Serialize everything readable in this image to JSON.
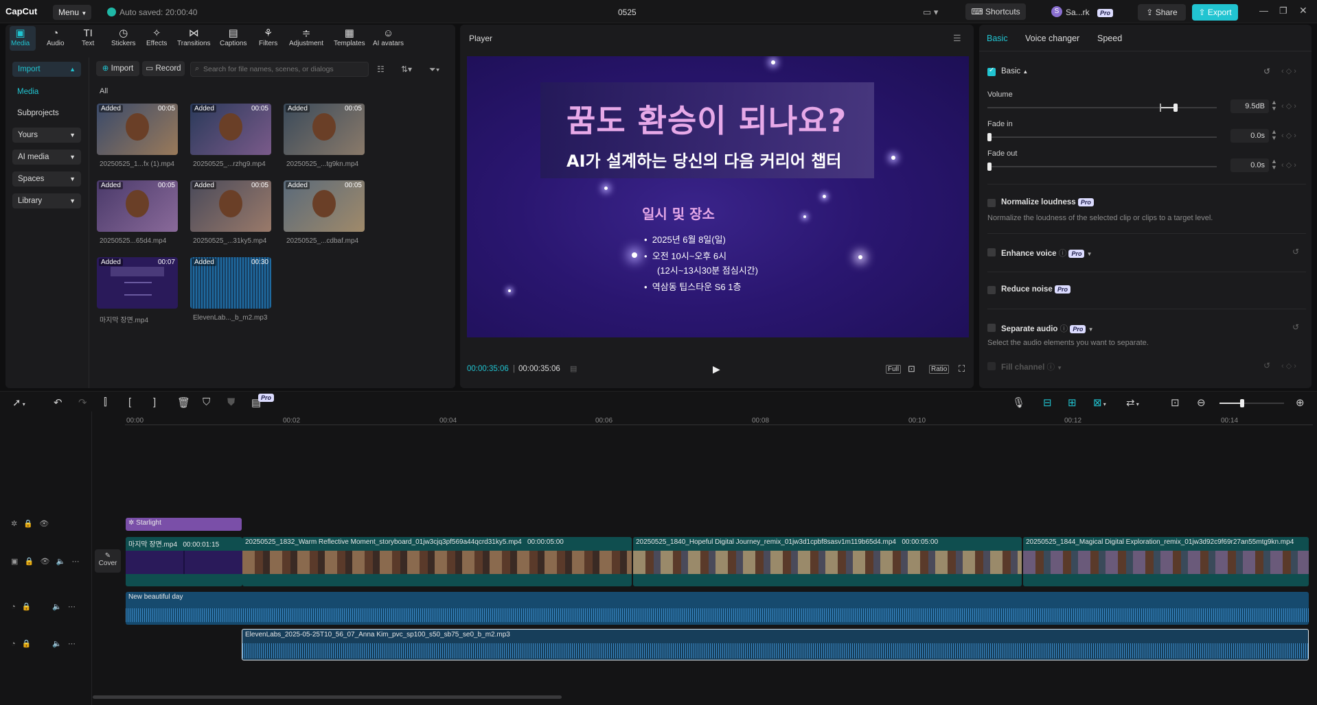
{
  "app": {
    "name": "CapCut",
    "menu_label": "Menu",
    "autosave": "Auto saved: 20:00:40",
    "project_title": "0525"
  },
  "topbar": {
    "shortcuts": "Shortcuts",
    "user": "Sa...rk",
    "pro_badge": "Pro",
    "share": "Share",
    "export": "Export",
    "user_initial": "S"
  },
  "toolbar": {
    "items": [
      "Media",
      "Audio",
      "Text",
      "Stickers",
      "Effects",
      "Transitions",
      "Captions",
      "Filters",
      "Adjustment",
      "Templates",
      "AI avatars"
    ]
  },
  "sidebar": {
    "import": "Import",
    "media": "Media",
    "subprojects": "Subprojects",
    "yours": "Yours",
    "ai_media": "AI media",
    "spaces": "Spaces",
    "library": "Library"
  },
  "media_panel": {
    "import_btn": "Import",
    "record_btn": "Record",
    "search_placeholder": "Search for file names, scenes, or dialogs",
    "filter_all": "All",
    "items": [
      {
        "name": "20250525_1...fx (1).mp4",
        "badge": "Added",
        "duration": "00:05"
      },
      {
        "name": "20250525_...rzhg9.mp4",
        "badge": "Added",
        "duration": "00:05"
      },
      {
        "name": "20250525_...tg9kn.mp4",
        "badge": "Added",
        "duration": "00:05"
      },
      {
        "name": "20250525...65d4.mp4",
        "badge": "Added",
        "duration": "00:05"
      },
      {
        "name": "20250525_...31ky5.mp4",
        "badge": "Added",
        "duration": "00:05"
      },
      {
        "name": "20250525_...cdbaf.mp4",
        "badge": "Added",
        "duration": "00:05"
      },
      {
        "name": "마지막 장면.mp4",
        "badge": "Added",
        "duration": "00:07"
      },
      {
        "name": "ElevenLab..._b_m2.mp3",
        "badge": "Added",
        "duration": "00:30"
      }
    ]
  },
  "player": {
    "title": "Player",
    "headline": "꿈도 환승이 되나요?",
    "subheadline": "AI가 설계하는 당신의 다음 커리어 챕터",
    "section_title": "일시 및 장소",
    "bullets": [
      "2025년 6월 8일(일)",
      "오전 10시~오후 6시",
      "(12시~13시30분 점심시간)",
      "역삼동 팁스타운 S6 1층"
    ],
    "current_time": "00:00:35:06",
    "total_time": "00:00:35:06",
    "btn_full": "Full",
    "btn_ratio": "Ratio"
  },
  "right_panel": {
    "tabs": [
      "Basic",
      "Voice changer",
      "Speed"
    ],
    "basic_label": "Basic",
    "volume_label": "Volume",
    "volume_value": "9.5dB",
    "volume_level": 0.82,
    "fade_in_label": "Fade in",
    "fade_in_value": "0.0s",
    "fade_out_label": "Fade out",
    "fade_out_value": "0.0s",
    "normalize_label": "Normalize loudness",
    "normalize_desc": "Normalize the loudness of the selected clip or clips to a target level.",
    "enhance_label": "Enhance voice",
    "reduce_label": "Reduce noise",
    "separate_label": "Separate audio",
    "separate_desc": "Select the audio elements you want to separate.",
    "fill_label": "Fill channel"
  },
  "timeline": {
    "ruler": [
      "00:00",
      "00:02",
      "00:04",
      "00:06",
      "00:08",
      "00:10",
      "00:12",
      "00:14"
    ],
    "effect_clip": "Starlight",
    "cover_label": "Cover",
    "video_clips": [
      {
        "name": "마지막 장면.mp4",
        "duration": "00:00:01:15"
      },
      {
        "name": "20250525_1832_Warm Reflective Moment_storyboard_01jw3cjq3pf569a44qcrd31ky5.mp4",
        "duration": "00:00:05:00"
      },
      {
        "name": "20250525_1840_Hopeful Digital Journey_remix_01jw3d1cpbf8sasv1m119b65d4.mp4",
        "duration": "00:00:05:00"
      },
      {
        "name": "20250525_1844_Magical Digital Exploration_remix_01jw3d92c9f69r27an55mtg9kn.mp4",
        "duration": ""
      }
    ],
    "audio_clip_1": "New beautiful day",
    "audio_clip_2": "ElevenLabs_2025-05-25T10_56_07_Anna Kim_pvc_sp100_s50_sb75_se0_b_m2.mp3"
  },
  "colors": {
    "accent": "#21c4d1",
    "bg": "#0f0f10",
    "panel": "#1b1b1d",
    "audio": "#1f5f8a",
    "video": "#0f4e4f",
    "effect": "#7a4fa8"
  }
}
